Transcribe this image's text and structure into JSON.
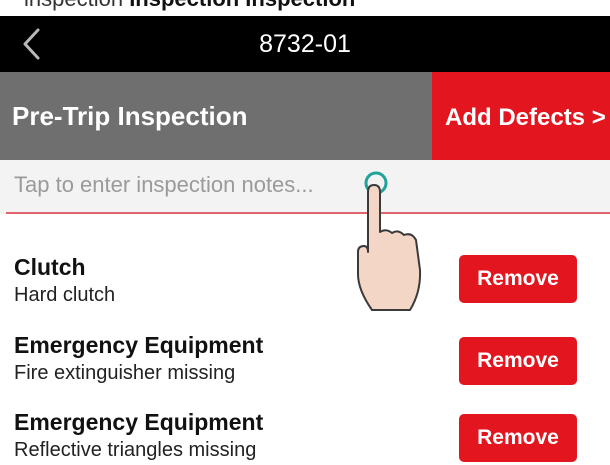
{
  "caption": {
    "pre": "inspection ",
    "bold": "Inspection Inspection"
  },
  "nav": {
    "back_icon": "chevron-left-icon",
    "title": "8732-01"
  },
  "header": {
    "title": "Pre-Trip Inspection",
    "add_defects_label": "Add Defects >"
  },
  "notes": {
    "placeholder": "Tap to enter inspection notes..."
  },
  "defects": [
    {
      "name": "Clutch",
      "description": "Hard clutch",
      "remove_label": "Remove"
    },
    {
      "name": "Emergency Equipment",
      "description": "Fire extinguisher missing",
      "remove_label": "Remove"
    },
    {
      "name": "Emergency Equipment",
      "description": "Reflective triangles missing",
      "remove_label": "Remove"
    }
  ],
  "colors": {
    "nav_bg": "#000000",
    "header_bg": "#6f6f6f",
    "accent_red": "#e3151f",
    "notes_underline": "#e0656f"
  },
  "overlay": {
    "icon": "tap-hand-icon"
  }
}
